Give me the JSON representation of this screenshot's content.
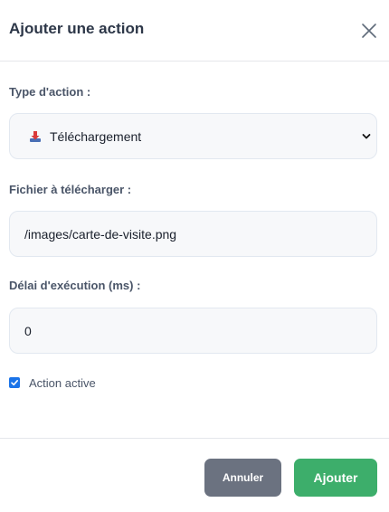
{
  "modal": {
    "title": "Ajouter une action",
    "close_icon": "close-icon"
  },
  "form": {
    "action_type": {
      "label": "Type d'action :",
      "selected": "Téléchargement",
      "icon": "download-icon"
    },
    "file": {
      "label": "Fichier à télécharger :",
      "value": "/images/carte-de-visite.png"
    },
    "delay": {
      "label": "Délai d'exécution (ms) :",
      "value": "0"
    },
    "active": {
      "label": "Action active",
      "checked": true
    }
  },
  "footer": {
    "cancel_label": "Annuler",
    "add_label": "Ajouter"
  },
  "colors": {
    "cancel": "#6b7280",
    "add": "#3dae6b",
    "checkbox": "#1a73e8"
  }
}
